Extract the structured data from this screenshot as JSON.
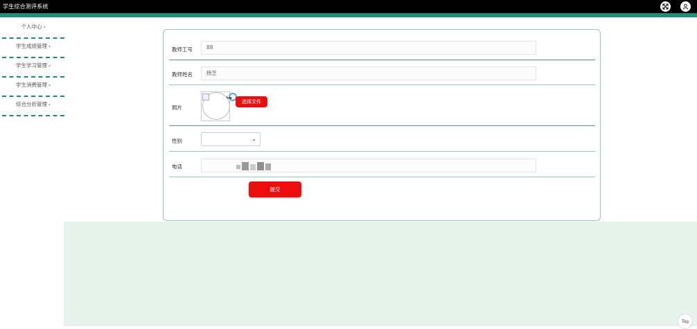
{
  "app": {
    "title": "学生综合测评系统"
  },
  "header": {
    "fullscreen_icon": "fullscreen-icon",
    "user_icon": "user-icon"
  },
  "sidebar": {
    "items": [
      {
        "label": "个人中心"
      },
      {
        "label": "学生成绩管理"
      },
      {
        "label": "学生学习管理"
      },
      {
        "label": "学生消费管理"
      },
      {
        "label": "综合分析管理"
      }
    ]
  },
  "form": {
    "teacher_id": {
      "label": "教师工号",
      "value": "88"
    },
    "teacher_name": {
      "label": "教师姓名",
      "value": "杨芝"
    },
    "photo": {
      "label": "照片",
      "upload_label": "选择文件"
    },
    "gender": {
      "label": "性别",
      "value": ""
    },
    "phone": {
      "label": "电话",
      "value": ""
    },
    "submit_label": "提交"
  },
  "back_to_top": {
    "label": "Top"
  },
  "colors": {
    "topbar": "#000000",
    "accent": "#1e8e7d",
    "button": "#ee0d0d",
    "bottom_panel": "#e6f3ec"
  }
}
